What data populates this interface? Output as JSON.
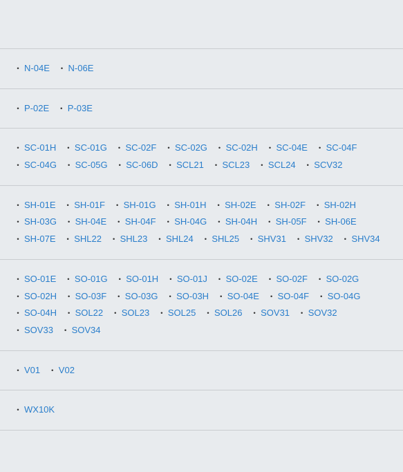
{
  "groups": [
    {
      "items": [
        "N-04E",
        "N-06E"
      ]
    },
    {
      "items": [
        "P-02E",
        "P-03E"
      ]
    },
    {
      "items": [
        "SC-01H",
        "SC-01G",
        "SC-02F",
        "SC-02G",
        "SC-02H",
        "SC-04E",
        "SC-04F",
        "SC-04G",
        "SC-05G",
        "SC-06D",
        "SCL21",
        "SCL23",
        "SCL24",
        "SCV32"
      ]
    },
    {
      "items": [
        "SH-01E",
        "SH-01F",
        "SH-01G",
        "SH-01H",
        "SH-02E",
        "SH-02F",
        "SH-02H",
        "SH-03G",
        "SH-04E",
        "SH-04F",
        "SH-04G",
        "SH-04H",
        "SH-05F",
        "SH-06E",
        "SH-07E",
        "SHL22",
        "SHL23",
        "SHL24",
        "SHL25",
        "SHV31",
        "SHV32",
        "SHV34"
      ]
    },
    {
      "items": [
        "SO-01E",
        "SO-01G",
        "SO-01H",
        "SO-01J",
        "SO-02E",
        "SO-02F",
        "SO-02G",
        "SO-02H",
        "SO-03F",
        "SO-03G",
        "SO-03H",
        "SO-04E",
        "SO-04F",
        "SO-04G",
        "SO-04H",
        "SOL22",
        "SOL23",
        "SOL25",
        "SOL26",
        "SOV31",
        "SOV32",
        "SOV33",
        "SOV34"
      ]
    },
    {
      "items": [
        "V01",
        "V02"
      ]
    },
    {
      "items": [
        "WX10K"
      ]
    }
  ]
}
